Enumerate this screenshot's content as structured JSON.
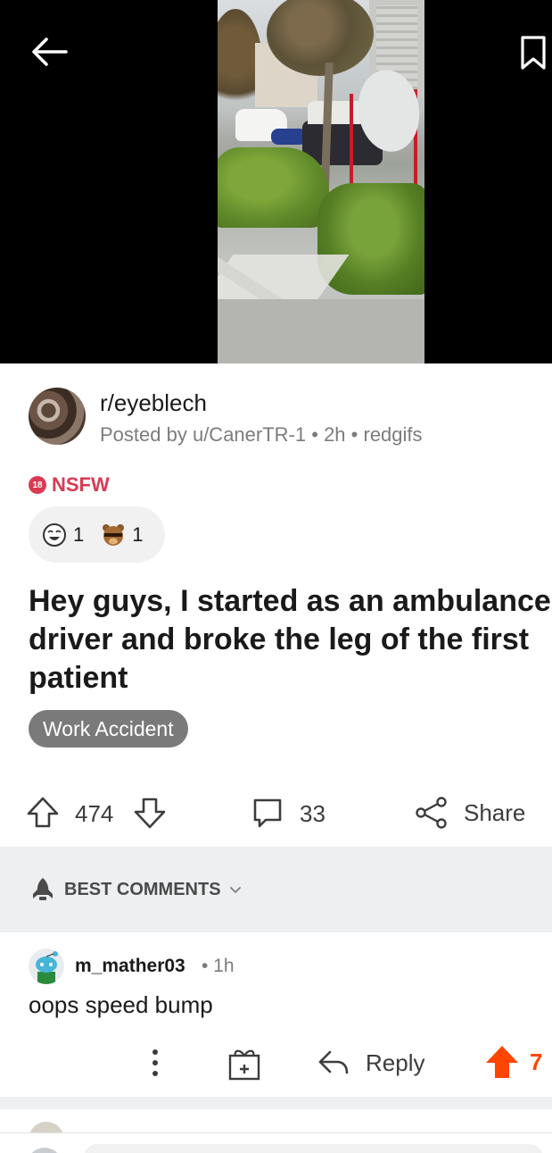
{
  "header": {
    "back_icon": "arrow-left-icon",
    "bookmark_icon": "bookmark-icon"
  },
  "post": {
    "subreddit": "r/eyeblech",
    "author_line": "Posted by u/CanerTR-1",
    "separator": "•",
    "age": "2h",
    "source": "redgifs",
    "nsfw_badge": "18",
    "nsfw_label": "NSFW",
    "awards": [
      {
        "icon": "laughing-face-award-icon",
        "count": "1"
      },
      {
        "icon": "bear-award-icon",
        "count": "1"
      }
    ],
    "title": "Hey guys, I started as an ambulance driver and broke the leg of the first patient",
    "flair": "Work Accident",
    "votes": "474",
    "comments": "33",
    "share_label": "Share"
  },
  "sort": {
    "label": "BEST COMMENTS"
  },
  "comment": {
    "username": "m_mather03",
    "time": "• 1h",
    "body": "oops speed bump",
    "reply_label": "Reply",
    "upvotes": "7"
  },
  "colors": {
    "accent": "#ff4500",
    "nsfw": "#d93a53",
    "flair_bg": "#7a7a7a"
  }
}
